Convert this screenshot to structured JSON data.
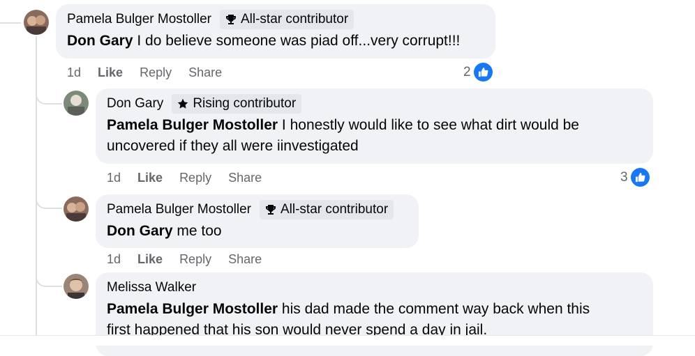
{
  "comments": [
    {
      "author": "Pamela Bulger Mostoller",
      "badge": "All-star contributor",
      "badge_icon": "trophy-icon",
      "mention": "Don Gary",
      "text": " I do believe someone was piad off...very corrupt!!!",
      "time": "1d",
      "like": "Like",
      "reply": "Reply",
      "share": "Share",
      "reactions": "2"
    },
    {
      "author": "Don Gary",
      "badge": "Rising contributor",
      "badge_icon": "star-icon",
      "mention": "Pamela Bulger Mostoller",
      "text": " I honestly would like to see what dirt would be",
      "text2": "uncovered if they all were iinvestigated",
      "time": "1d",
      "like": "Like",
      "reply": "Reply",
      "share": "Share",
      "reactions": "3"
    },
    {
      "author": "Pamela Bulger Mostoller",
      "badge": "All-star contributor",
      "badge_icon": "trophy-icon",
      "mention": "Don Gary",
      "text": " me too",
      "time": "1d",
      "like": "Like",
      "reply": "Reply",
      "share": "Share"
    },
    {
      "author": "Melissa Walker",
      "mention": "Pamela Bulger Mostoller",
      "text": " his dad made the comment way back when this",
      "text2": "first happened that his son would never spend a day in jail."
    }
  ],
  "colors": {
    "like_blue": "#1877f2",
    "bubble": "#f0f2f5",
    "badge": "#e4e6eb",
    "meta": "#65676b"
  }
}
